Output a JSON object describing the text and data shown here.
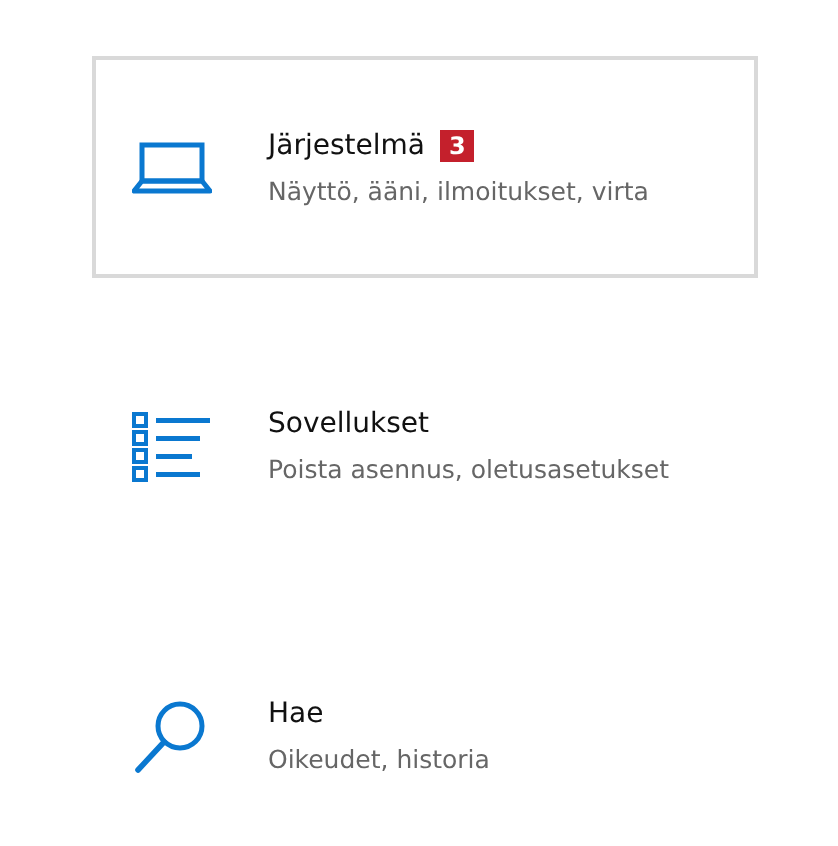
{
  "tiles": [
    {
      "kind": "laptop",
      "title": "Järjestelmä",
      "badge": "3",
      "subtitle": "Näyttö, ääni, ilmoitukset, virta",
      "selected": true
    },
    {
      "kind": "apps",
      "title": "Sovellukset",
      "subtitle": "Poista asennus, oletusasetukset",
      "selected": false
    },
    {
      "kind": "search",
      "title": "Hae",
      "subtitle": "Oikeudet, historia",
      "selected": false
    }
  ]
}
